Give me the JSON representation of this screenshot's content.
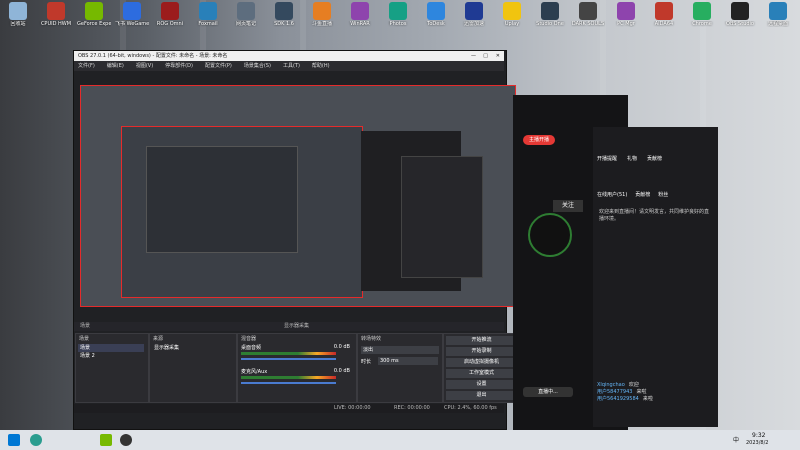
{
  "desktop_icons": [
    {
      "label": "回收站",
      "color": "#8fb5d8"
    },
    {
      "label": "CPUID HWM",
      "color": "#c0392b"
    },
    {
      "label": "GeForce Experience",
      "color": "#76b900"
    },
    {
      "label": "飞书 WeGame",
      "color": "#2d6cdf"
    },
    {
      "label": "ROG Omni",
      "color": "#9b1c1c"
    },
    {
      "label": "Foxmail",
      "color": "#2980b9"
    },
    {
      "label": "网页笔记",
      "color": "#5d6d7e"
    },
    {
      "label": "SDK 1.6",
      "color": "#34495e"
    },
    {
      "label": "斗鱼直播",
      "color": "#e67e22"
    },
    {
      "label": "WinRAR",
      "color": "#8e44ad"
    },
    {
      "label": "Photos",
      "color": "#16a085"
    },
    {
      "label": "ToDesk",
      "color": "#2e86de"
    },
    {
      "label": "迅雷加速",
      "color": "#1f3a93"
    },
    {
      "label": "Uplay",
      "color": "#f1c40f"
    },
    {
      "label": "Studio One",
      "color": "#2c3e50"
    },
    {
      "label": "DARK SOULS",
      "color": "#444"
    },
    {
      "label": "PC Mgr",
      "color": "#8e44ad"
    },
    {
      "label": "AIDA64",
      "color": "#c0392b"
    },
    {
      "label": "Chrome",
      "color": "#27ae60"
    },
    {
      "label": "OBS Studio",
      "color": "#222"
    },
    {
      "label": "远程桌面",
      "color": "#2980b9"
    }
  ],
  "obs": {
    "title": "OBS 27.0.1 (64-bit, windows) - 配置文件: 未命名 - 场景: 未命名",
    "menu": [
      "文件(F)",
      "编辑(E)",
      "视图(V)",
      "停靠部件(D)",
      "配置文件(P)",
      "场景集合(S)",
      "工具(T)",
      "帮助(H)"
    ],
    "scenes_title": "场景",
    "sources_title": "来源",
    "mixer_title": "混音器",
    "transitions_title": "转场特效",
    "controls_title": "控件",
    "scenes": [
      "场景",
      "场景 2"
    ],
    "sources": [
      "显示器采集"
    ],
    "mixer": [
      {
        "name": "桌面音频",
        "db": "0.0 dB"
      },
      {
        "name": "麦克风/Aux",
        "db": "0.0 dB"
      }
    ],
    "transition": "淡出",
    "duration_label": "时长",
    "duration": "300 ms",
    "controls": [
      "开始推流",
      "开始录制",
      "启动虚拟摄像机",
      "工作室模式",
      "设置",
      "退出"
    ],
    "status": {
      "live": "LIVE: 00:00:00",
      "rec": "REC: 00:00:00",
      "cpu": "CPU: 2.4%, 60.00 fps"
    },
    "preview_bar": "显示器采集"
  },
  "live_panel": {
    "tabs": [
      "开播提醒",
      "礼物",
      "贡献榜"
    ],
    "sub_tabs": [
      "在线用户(51)",
      "贡献榜",
      "粉丝"
    ],
    "tip": "欢迎来到直播间！请文明发言，共同维护良好的直播环境。",
    "big_button": "主播开播",
    "status_button": "直播中...",
    "follow_label": "关注",
    "messages": [
      {
        "user": "Xlqingchao",
        "text": "欢迎"
      },
      {
        "user": "用户58477943",
        "text": "来啦"
      },
      {
        "user": "用户5641929584",
        "text": "来啦"
      }
    ]
  },
  "taskbar": {
    "time": "9:32",
    "date": "2023/8/2",
    "ime": "中"
  }
}
